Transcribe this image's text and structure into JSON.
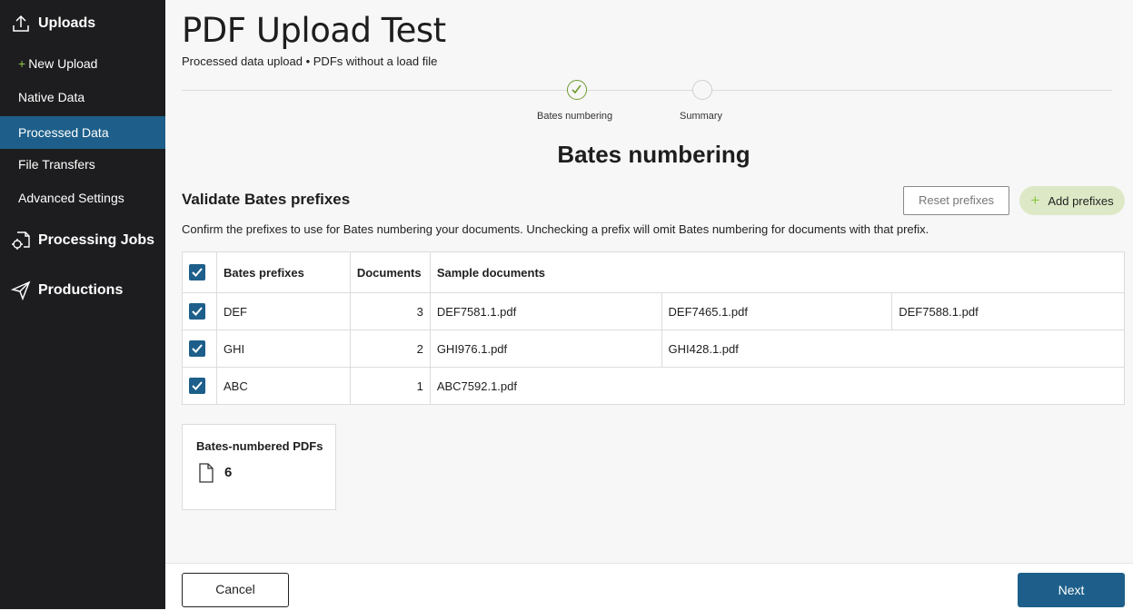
{
  "sidebar": {
    "uploads": {
      "label": "Uploads",
      "icon": "upload-icon"
    },
    "items": [
      {
        "label": "New Upload",
        "plus": "+"
      },
      {
        "label": "Native Data"
      },
      {
        "label": "Processed Data",
        "active": true
      },
      {
        "label": "File Transfers"
      },
      {
        "label": "Advanced Settings"
      }
    ],
    "processing_jobs": {
      "label": "Processing Jobs",
      "icon": "processing-jobs-icon"
    },
    "productions": {
      "label": "Productions",
      "icon": "send-icon"
    }
  },
  "page": {
    "title": "PDF Upload Test",
    "subtitle": "Processed data upload • PDFs without a load file"
  },
  "stepper": {
    "steps": [
      {
        "label": "Bates numbering",
        "state": "done"
      },
      {
        "label": "Summary",
        "state": "todo"
      }
    ]
  },
  "section_heading": "Bates numbering",
  "validate": {
    "title": "Validate Bates prefixes",
    "reset_label": "Reset prefixes",
    "add_label": "Add prefixes",
    "instructions": "Confirm the prefixes to use for Bates numbering your documents. Unchecking a prefix will omit Bates numbering for documents with that prefix."
  },
  "table": {
    "headers": {
      "prefix": "Bates prefixes",
      "documents": "Documents",
      "samples": "Sample documents"
    },
    "rows": [
      {
        "prefix": "DEF",
        "documents": "3",
        "samples": [
          "DEF7581.1.pdf",
          "DEF7465.1.pdf",
          "DEF7588.1.pdf"
        ],
        "checked": true
      },
      {
        "prefix": "GHI",
        "documents": "2",
        "samples": [
          "GHI976.1.pdf",
          "GHI428.1.pdf",
          ""
        ],
        "checked": true
      },
      {
        "prefix": "ABC",
        "documents": "1",
        "samples": [
          "ABC7592.1.pdf",
          "",
          ""
        ],
        "checked": true
      }
    ]
  },
  "summary_card": {
    "title": "Bates-numbered PDFs",
    "value": "6",
    "icon": "document-icon"
  },
  "footer": {
    "cancel_label": "Cancel",
    "next_label": "Next"
  },
  "colors": {
    "accent": "#1d5f8a",
    "success": "#6e9b2c",
    "add_button_bg": "#dde9c6",
    "sidebar_bg": "#1d1d1f"
  }
}
